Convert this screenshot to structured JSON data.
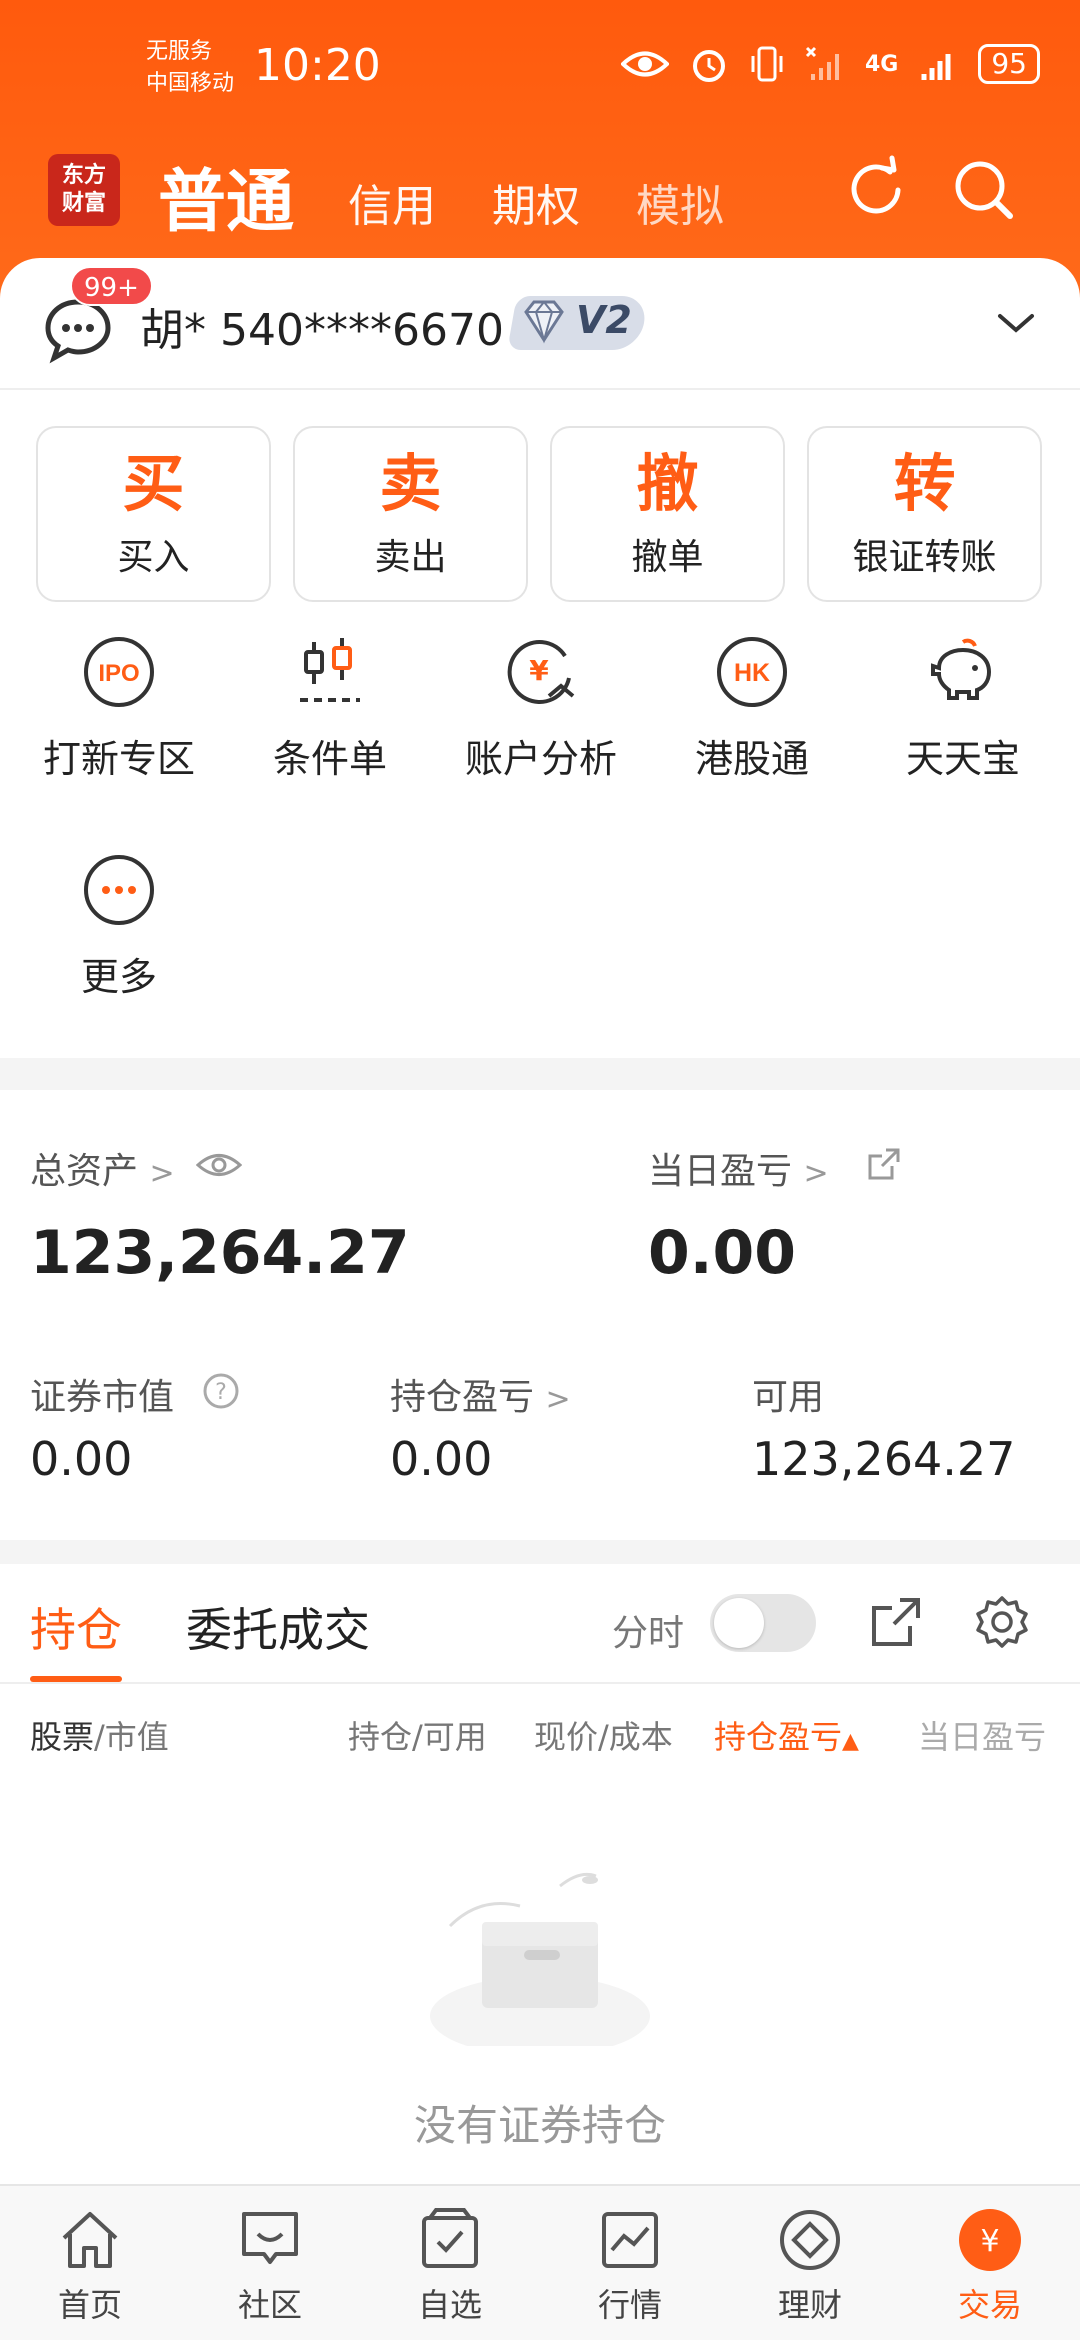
{
  "status": {
    "carrier_line1": "无服务",
    "carrier_line2": "中国移动",
    "time": "10:20",
    "network": "4G",
    "battery": "95"
  },
  "header": {
    "logo_line1": "东方",
    "logo_line2": "财富",
    "tabs": [
      {
        "label": "普通"
      },
      {
        "label": "信用"
      },
      {
        "label": "期权"
      },
      {
        "label": "模拟"
      }
    ]
  },
  "account": {
    "badge": "99+",
    "name": "胡* 540****6670",
    "level": "V2"
  },
  "actions": [
    {
      "big": "买",
      "label": "买入"
    },
    {
      "big": "卖",
      "label": "卖出"
    },
    {
      "big": "撤",
      "label": "撤单"
    },
    {
      "big": "转",
      "label": "银证转账"
    }
  ],
  "functions": [
    {
      "label": "打新专区",
      "icon": "ipo-icon"
    },
    {
      "label": "条件单",
      "icon": "candlestick-icon"
    },
    {
      "label": "账户分析",
      "icon": "yuan-analysis-icon"
    },
    {
      "label": "港股通",
      "icon": "hk-icon"
    },
    {
      "label": "天天宝",
      "icon": "piggy-bank-icon"
    },
    {
      "label": "更多",
      "icon": "more-icon"
    }
  ],
  "assets": {
    "total_label": "总资产",
    "total_value": "123,264.27",
    "daily_label": "当日盈亏",
    "daily_value": "0.00",
    "market_label": "证券市值",
    "market_value": "0.00",
    "hold_pl_label": "持仓盈亏",
    "hold_pl_value": "0.00",
    "available_label": "可用",
    "available_value": "123,264.27"
  },
  "positions": {
    "tab_active": "持仓",
    "tab_other": "委托成交",
    "fenshi": "分时",
    "columns": {
      "stock": "股票",
      "stock_sub": "/市值",
      "hold": "持仓/可用",
      "price": "现价/成本",
      "pl": "持仓盈亏",
      "daily": "当日盈亏"
    },
    "empty": "没有证券持仓"
  },
  "bottom_nav": [
    {
      "label": "首页",
      "icon": "home-icon"
    },
    {
      "label": "社区",
      "icon": "community-icon"
    },
    {
      "label": "自选",
      "icon": "watchlist-icon"
    },
    {
      "label": "行情",
      "icon": "market-icon"
    },
    {
      "label": "理财",
      "icon": "wealth-icon"
    },
    {
      "label": "交易",
      "icon": "trade-icon"
    }
  ],
  "colors": {
    "accent": "#ff5d15",
    "header": "#ff5a0d"
  }
}
